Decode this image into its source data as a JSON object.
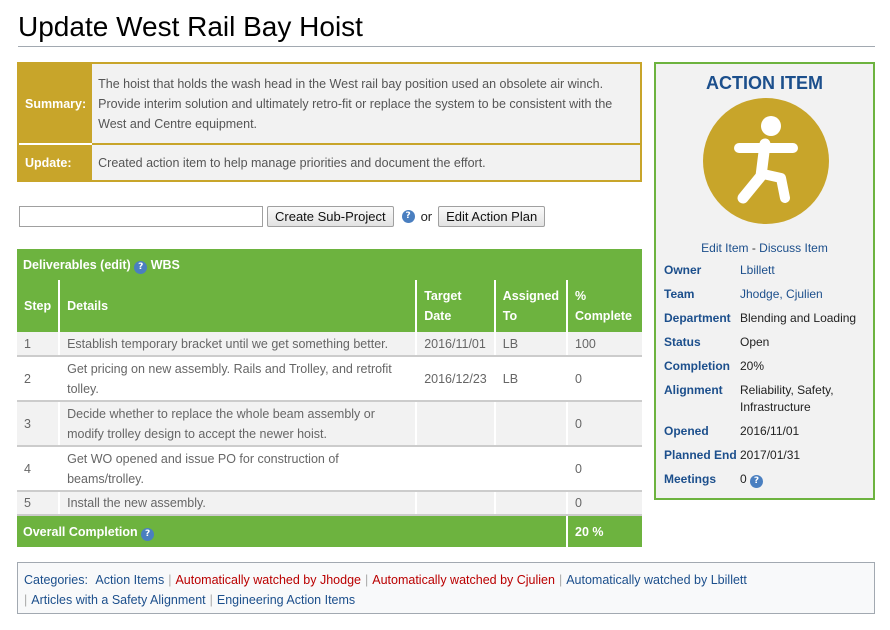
{
  "title": "Update West Rail Bay Hoist",
  "summary": {
    "summary_label": "Summary:",
    "summary_text": "The hoist that holds the wash head in the West rail bay position used an obsolete air winch. Provide interim solution and ultimately retro-fit or replace the system to be consistent with the West and Centre equipment.",
    "update_label": "Update:",
    "update_text": "Created action item to help manage priorities and document the effort."
  },
  "subproject": {
    "input_value": "",
    "create_label": "Create Sub-Project",
    "help": "?",
    "or": "or",
    "edit_plan_label": "Edit Action Plan"
  },
  "deliverables": {
    "caption": "Deliverables",
    "edit": "(edit)",
    "help": "?",
    "wbs": "WBS",
    "headers": [
      "Step",
      "Details",
      "Target Date",
      "Assigned To",
      "% Complete"
    ],
    "rows": [
      {
        "step": "1",
        "details": "Establish temporary bracket until we get something better.",
        "date": "2016/11/01",
        "assigned": "LB",
        "pct": "100"
      },
      {
        "step": "2",
        "details": "Get pricing on new assembly. Rails and Trolley, and retrofit tolley.",
        "date": "2016/12/23",
        "assigned": "LB",
        "pct": "0"
      },
      {
        "step": "3",
        "details": "Decide whether to replace the whole beam assembly or modify trolley design to accept the newer hoist.",
        "date": "",
        "assigned": "",
        "pct": "0"
      },
      {
        "step": "4",
        "details": "Get WO opened and issue PO for construction of beams/trolley.",
        "date": "",
        "assigned": "",
        "pct": "0"
      },
      {
        "step": "5",
        "details": "Install the new assembly.",
        "date": "",
        "assigned": "",
        "pct": "0"
      }
    ],
    "overall_label": "Overall Completion",
    "overall_help": "?",
    "overall_value": "20 %"
  },
  "action_item": {
    "title": "ACTION ITEM",
    "icon": "action-figure-icon",
    "icon_color": "#c8a52a",
    "edit_item": "Edit Item",
    "dash": " - ",
    "discuss_item": "Discuss Item",
    "props": {
      "owner_k": "Owner",
      "owner_v": "Lbillett",
      "team_k": "Team",
      "team_v": "Jhodge, Cjulien",
      "department_k": "Department",
      "department_v": "Blending and Loading",
      "status_k": "Status",
      "status_v": "Open",
      "completion_k": "Completion",
      "completion_v": "20%",
      "alignment_k": "Alignment",
      "alignment_v": "Reliability, Safety, Infrastructure",
      "opened_k": "Opened",
      "opened_v": "2016/11/01",
      "planned_end_k": "Planned End",
      "planned_end_v": "2017/01/31",
      "meetings_k": "Meetings",
      "meetings_v": "0",
      "meetings_help": "?"
    }
  },
  "categories": {
    "label": "Categories:",
    "items": [
      "Action Items",
      "Automatically watched by Jhodge",
      "Automatically watched by Cjulien",
      "Automatically watched by Lbillett",
      "Articles with a Safety Alignment",
      "Engineering Action Items"
    ],
    "sep": "|"
  },
  "colors": {
    "gold": "#c8a52a",
    "green": "#6db33f",
    "link_blue": "#1c4f8c",
    "redlink": "#ba0000"
  }
}
